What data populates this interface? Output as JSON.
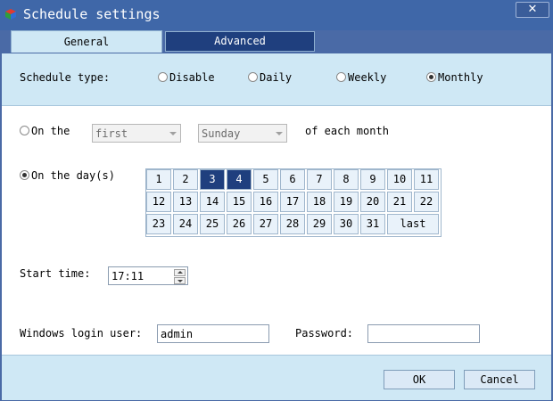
{
  "window": {
    "title": "Schedule settings",
    "close_label": "✕"
  },
  "tabs": [
    {
      "label": "General",
      "active": true
    },
    {
      "label": "Advanced",
      "active": false
    }
  ],
  "schedule_type": {
    "label": "Schedule type:",
    "options": [
      "Disable",
      "Daily",
      "Weekly",
      "Monthly"
    ],
    "selected": "Monthly"
  },
  "on_the": {
    "label": "On the",
    "ordinal": "first",
    "weekday": "Sunday",
    "suffix": "of each month",
    "selected": false
  },
  "on_days": {
    "label": "On the day(s)",
    "selected": true,
    "days": [
      "1",
      "2",
      "3",
      "4",
      "5",
      "6",
      "7",
      "8",
      "9",
      "10",
      "11",
      "12",
      "13",
      "14",
      "15",
      "16",
      "17",
      "18",
      "19",
      "20",
      "21",
      "22",
      "23",
      "24",
      "25",
      "26",
      "27",
      "28",
      "29",
      "30",
      "31",
      "last"
    ],
    "selected_days": [
      "3",
      "4"
    ]
  },
  "start_time": {
    "label": "Start time:",
    "value": "17:11"
  },
  "login": {
    "user_label": "Windows login user:",
    "user_value": "admin",
    "password_label": "Password:",
    "password_value": ""
  },
  "buttons": {
    "ok": "OK",
    "cancel": "Cancel"
  },
  "colors": {
    "title_bar": "#3f67a8",
    "selected_day": "#1f3f7e",
    "panel": "#cfe8f5"
  }
}
